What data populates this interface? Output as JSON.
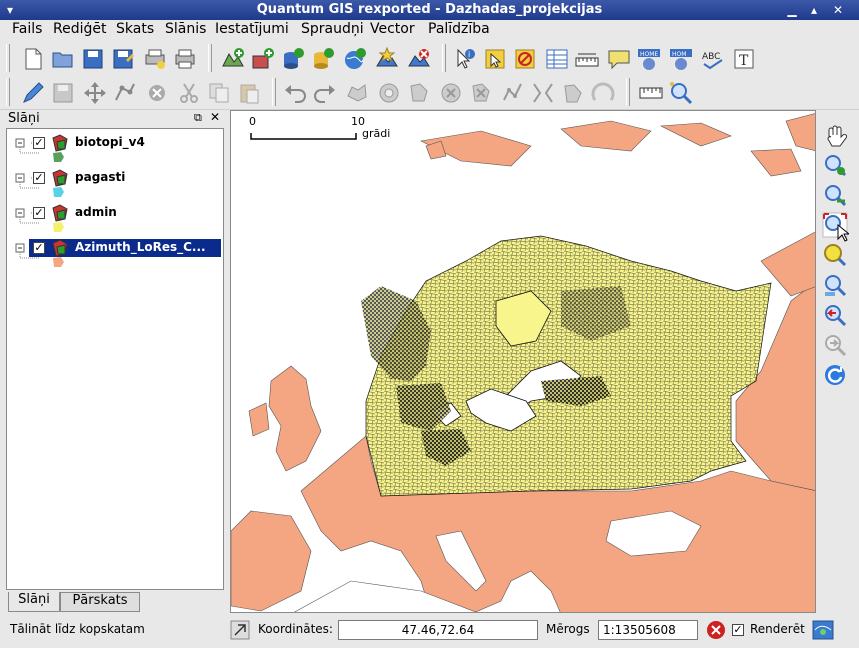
{
  "window": {
    "title": "Quantum GIS rexported - Dazhadas_projekcijas",
    "menu_icon": "chevron-down-icon",
    "controls": [
      "minimize-icon",
      "maximize-icon",
      "close-icon"
    ]
  },
  "menubar": {
    "items": [
      "Fails",
      "Rediģēt",
      "Skats",
      "Slānis",
      "Iestatījumi",
      "Spraudņi",
      "Vector",
      "Palīdzība"
    ]
  },
  "toolbar1": {
    "icons": [
      "new-project-icon",
      "open-project-icon",
      "save-project-icon",
      "save-as-icon",
      "print-composer-icon",
      "print-icon",
      "add-vector-icon",
      "add-raster-icon",
      "add-postgis-icon",
      "add-spatialite-icon",
      "add-wms-icon",
      "add-delimited-icon",
      "remove-layer-icon",
      "identify-icon",
      "select-icon",
      "deselect-icon",
      "attribute-table-icon",
      "measure-line-icon",
      "map-tips-icon",
      "home-icon",
      "home-alt-icon",
      "spellcheck-icon",
      "text-annotation-icon"
    ]
  },
  "toolbar2": {
    "icons": [
      "toggle-editing-icon",
      "save-edits-icon",
      "move-feature-icon",
      "node-tool-icon",
      "delete-icon",
      "cut-icon",
      "copy-icon",
      "paste-icon",
      "undo-icon",
      "redo-icon",
      "simplify-icon",
      "add-ring-icon",
      "add-part-icon",
      "delete-ring-icon",
      "delete-part-icon",
      "reshape-icon",
      "split-icon",
      "merge-icon",
      "offset-icon",
      "rotate-icon",
      "scale-icon",
      "zoom-best-icon"
    ]
  },
  "layers": {
    "title": "Slāņi",
    "items": [
      {
        "label": "biotopi_v4",
        "checked": true,
        "swatch": "#5aa05a"
      },
      {
        "label": "pagasti",
        "checked": true,
        "swatch": "#5ad2e6"
      },
      {
        "label": "admin",
        "checked": true,
        "swatch": "#f5ef6e"
      },
      {
        "label": "Azimuth_LoRes_C...",
        "checked": true,
        "swatch": "#f4a582",
        "selected": true
      }
    ],
    "tabs": [
      "Slāņi",
      "Pārskats"
    ]
  },
  "map": {
    "scalebar_labels": [
      "0",
      "10"
    ],
    "scalebar_unit": "grādi",
    "land_color": "#f4a582",
    "admin_color": "#f8f58c",
    "sea_color": "#ffffff"
  },
  "vtoolbar": {
    "icons": [
      "pan-icon",
      "zoom-in-icon",
      "zoom-out-icon",
      "zoom-full-icon",
      "zoom-layer-icon",
      "zoom-selection-icon",
      "zoom-last-icon",
      "zoom-next-icon",
      "refresh-icon"
    ]
  },
  "statusbar": {
    "message": "Tālināt līdz kopskatam",
    "coordinates_label": "Koordinātes:",
    "coordinates_value": "47.46,72.64",
    "scale_label": "Mērogs",
    "scale_value": "1:13505608",
    "render_label": "Renderēt",
    "render_checked": true
  }
}
